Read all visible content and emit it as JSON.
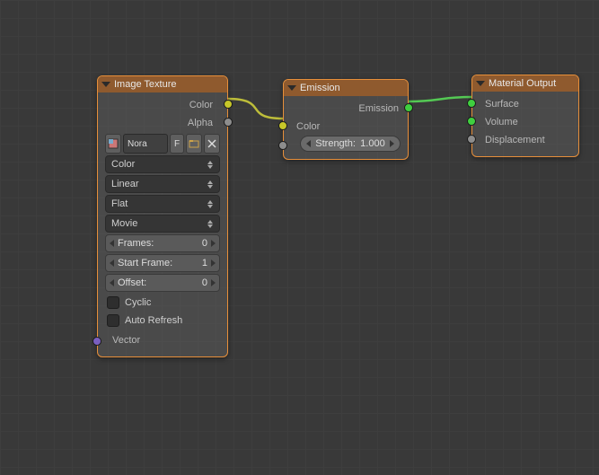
{
  "node_image_texture": {
    "title": "Image Texture",
    "outputs": {
      "color": "Color",
      "alpha": "Alpha"
    },
    "image_name": "Nora",
    "fake_user": "F",
    "dropdowns": {
      "color_space": "Color",
      "interpolation": "Linear",
      "projection": "Flat",
      "source": "Movie"
    },
    "anim": {
      "frames_label": "Frames:",
      "frames_value": "0",
      "start_label": "Start Frame:",
      "start_value": "1",
      "offset_label": "Offset:",
      "offset_value": "0",
      "cyclic": "Cyclic",
      "auto_refresh": "Auto Refresh"
    },
    "inputs": {
      "vector": "Vector"
    }
  },
  "node_emission": {
    "title": "Emission",
    "outputs": {
      "emission": "Emission"
    },
    "inputs": {
      "color": "Color",
      "strength_label": "Strength:",
      "strength_value": "1.000"
    }
  },
  "node_material_output": {
    "title": "Material Output",
    "inputs": {
      "surface": "Surface",
      "volume": "Volume",
      "displacement": "Displacement"
    }
  }
}
